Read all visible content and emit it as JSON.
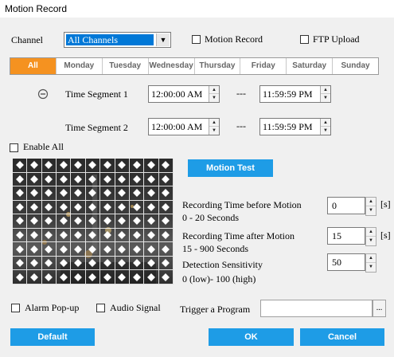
{
  "window": {
    "title": "Motion Record"
  },
  "channel": {
    "label": "Channel",
    "selected": "All Channels"
  },
  "options": {
    "motion_record": "Motion Record",
    "ftp_upload": "FTP Upload",
    "enable_all": "Enable All",
    "alarm_popup": "Alarm Pop-up",
    "audio_signal": "Audio Signal"
  },
  "days": [
    "All",
    "Monday",
    "Tuesday",
    "Wednesday",
    "Thursday",
    "Friday",
    "Saturday",
    "Sunday"
  ],
  "active_day": "All",
  "segments": [
    {
      "label": "Time Segment 1",
      "start": "12:00:00 AM",
      "end": "11:59:59 PM"
    },
    {
      "label": "Time Segment 2",
      "start": "12:00:00 AM",
      "end": "11:59:59 PM"
    }
  ],
  "dash": "---",
  "motion_test": "Motion Test",
  "settings": {
    "before": {
      "label": "Recording Time before Motion",
      "range": "0 - 20 Seconds",
      "value": "0",
      "unit": "[s]"
    },
    "after": {
      "label": "Recording Time after Motion",
      "range": "15 - 900 Seconds",
      "value": "15",
      "unit": "[s]"
    },
    "sensitivity": {
      "label": "Detection Sensitivity",
      "range": "0 (low)- 100 (high)",
      "value": "50"
    }
  },
  "trigger": {
    "label": "Trigger a Program",
    "value": "",
    "browse": "..."
  },
  "buttons": {
    "default": "Default",
    "ok": "OK",
    "cancel": "Cancel"
  },
  "colors": {
    "accent_orange": "#f59220",
    "button_blue": "#1e9ce6",
    "selection_blue": "#0078d7"
  },
  "icons": {
    "remove_segment": "minus-circle-icon",
    "dropdown": "chevron-down-icon"
  }
}
